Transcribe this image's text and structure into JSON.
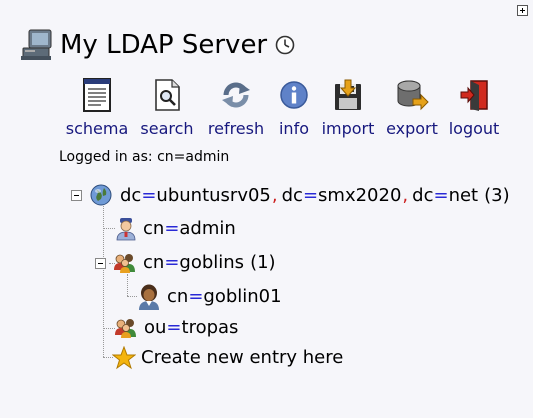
{
  "header": {
    "title": "My LDAP Server"
  },
  "toolbar": [
    {
      "id": "schema",
      "label": "schema",
      "icon": "document-icon"
    },
    {
      "id": "search",
      "label": "search",
      "icon": "magnifier-icon"
    },
    {
      "id": "refresh",
      "label": "refresh",
      "icon": "refresh-icon"
    },
    {
      "id": "info",
      "label": "info",
      "icon": "info-icon"
    },
    {
      "id": "import",
      "label": "import",
      "icon": "import-icon"
    },
    {
      "id": "export",
      "label": "export",
      "icon": "export-icon"
    },
    {
      "id": "logout",
      "label": "logout",
      "icon": "logout-icon"
    }
  ],
  "login": {
    "text": "Logged in as: cn=admin"
  },
  "tree": {
    "root": {
      "dc1": "ubuntusrv05",
      "dc2": "smx2020",
      "dc3": "net",
      "count": "(3)"
    },
    "admin": {
      "attr": "cn",
      "value": "admin"
    },
    "goblins": {
      "attr": "cn",
      "value": "goblins",
      "count": "(1)"
    },
    "goblin01": {
      "attr": "cn",
      "value": "goblin01"
    },
    "tropas": {
      "attr": "ou",
      "value": "tropas"
    },
    "create": {
      "label": "Create new entry here"
    }
  },
  "colors": {
    "link": "#17187e",
    "equals": "#2929d6",
    "comma": "#cc2020",
    "background": "#f6f6fa"
  }
}
